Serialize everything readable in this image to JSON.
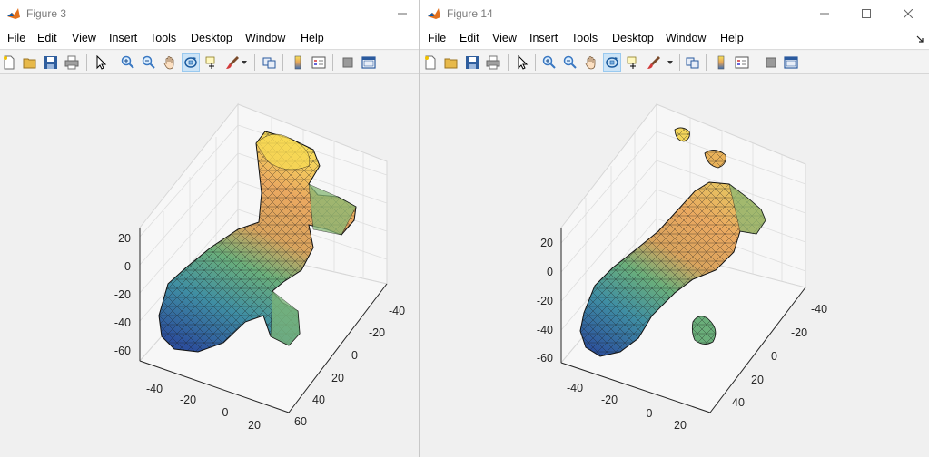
{
  "menu": [
    "File",
    "Edit",
    "View",
    "Insert",
    "Tools",
    "Desktop",
    "Window",
    "Help"
  ],
  "window1": {
    "title": "Figure 3",
    "z_ticks": [
      "20",
      "0",
      "-20",
      "-40",
      "-60"
    ],
    "x_ticks": [
      "-40",
      "-20",
      "0",
      "20"
    ],
    "y_ticks": [
      "-40",
      "-20",
      "0",
      "20",
      "40",
      "60"
    ]
  },
  "window2": {
    "title": "Figure 14",
    "z_ticks": [
      "20",
      "0",
      "-20",
      "-40",
      "-60"
    ],
    "x_ticks": [
      "-40",
      "-20",
      "0",
      "20"
    ],
    "y_ticks": [
      "-40",
      "-20",
      "0",
      "20",
      "40"
    ]
  },
  "toolbar_icons": [
    "new-figure-icon",
    "open-icon",
    "save-icon",
    "print-icon",
    "select-arrow-icon",
    "zoom-in-icon",
    "zoom-out-icon",
    "pan-hand-icon",
    "rotate-3d-icon",
    "data-cursor-icon",
    "brush-icon",
    "brush-dropdown-icon",
    "link-plot-icon",
    "colorbar-icon",
    "legend-icon",
    "hide-plot-tools-icon",
    "show-plot-tools-icon"
  ],
  "colors": {
    "surface_top": "#f9e25a",
    "surface_mid": "#e3a35a",
    "surface_green": "#86b775",
    "surface_bottom": "#3b6fb6",
    "accent": "#0072bd"
  }
}
